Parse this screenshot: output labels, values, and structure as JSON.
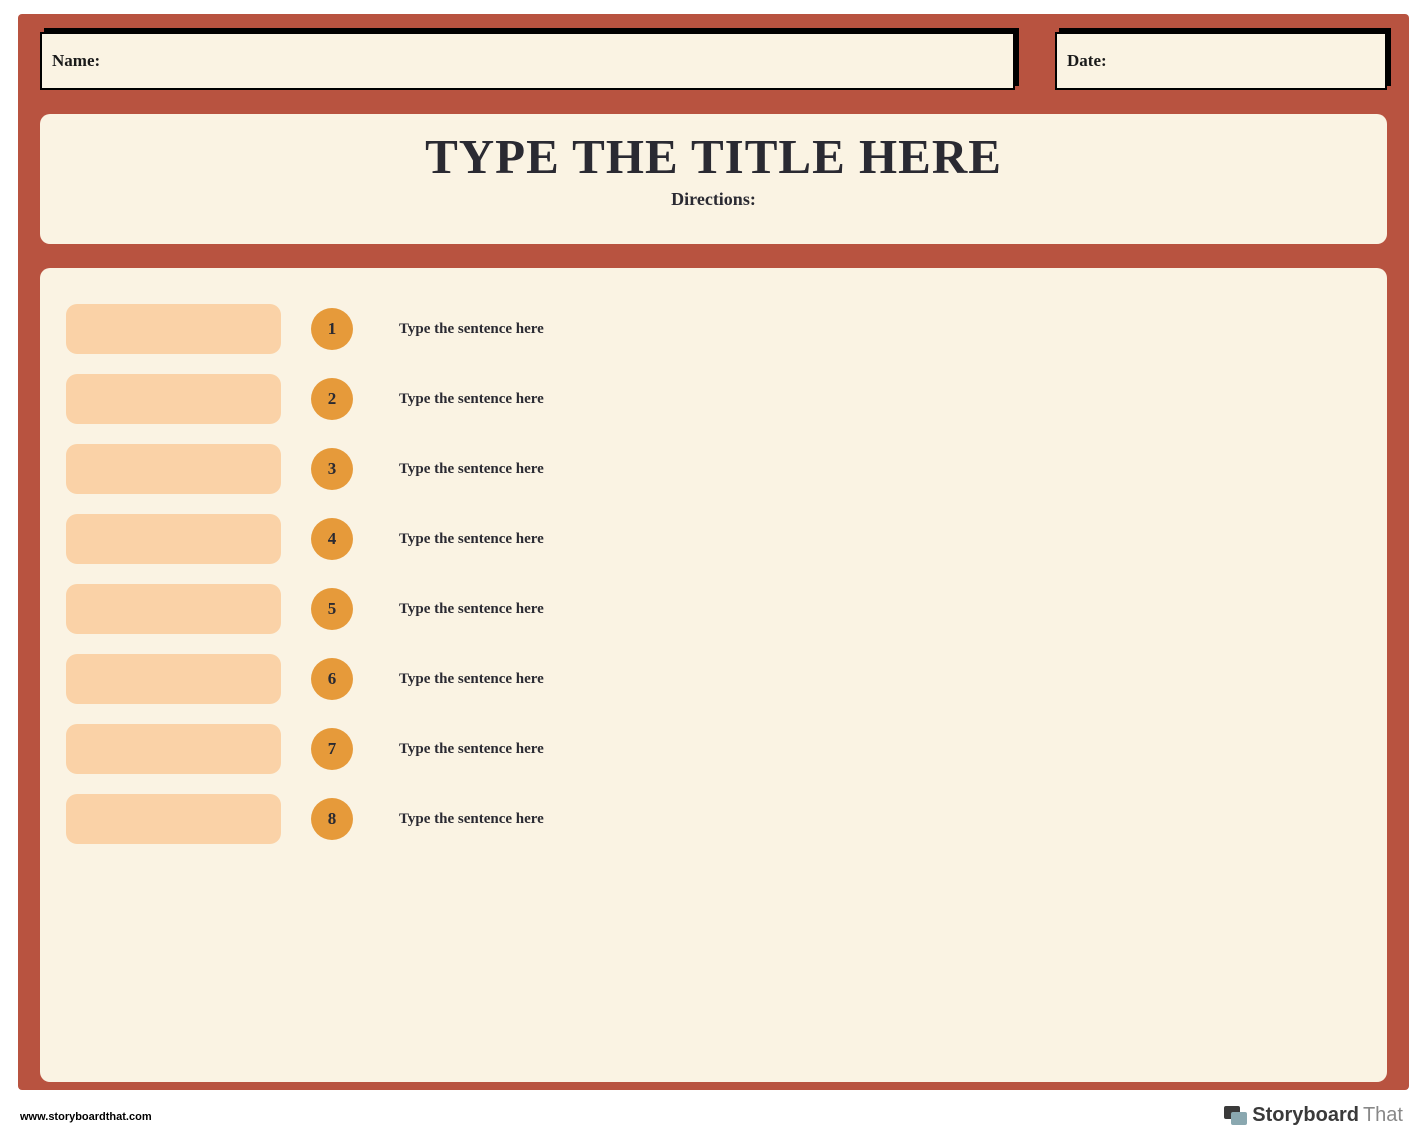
{
  "header": {
    "name_label": "Name:",
    "date_label": "Date:"
  },
  "title_panel": {
    "title": "TYPE THE TITLE HERE",
    "directions": "Directions:"
  },
  "rows": [
    {
      "num": "1",
      "text": "Type the sentence here"
    },
    {
      "num": "2",
      "text": "Type the sentence here"
    },
    {
      "num": "3",
      "text": "Type the sentence here"
    },
    {
      "num": "4",
      "text": "Type the sentence here"
    },
    {
      "num": "5",
      "text": "Type the sentence here"
    },
    {
      "num": "6",
      "text": "Type the sentence here"
    },
    {
      "num": "7",
      "text": "Type the sentence here"
    },
    {
      "num": "8",
      "text": "Type the sentence here"
    }
  ],
  "footer": {
    "url": "www.storyboardthat.com",
    "logo_part1": "Storyboard",
    "logo_part2": "That"
  }
}
